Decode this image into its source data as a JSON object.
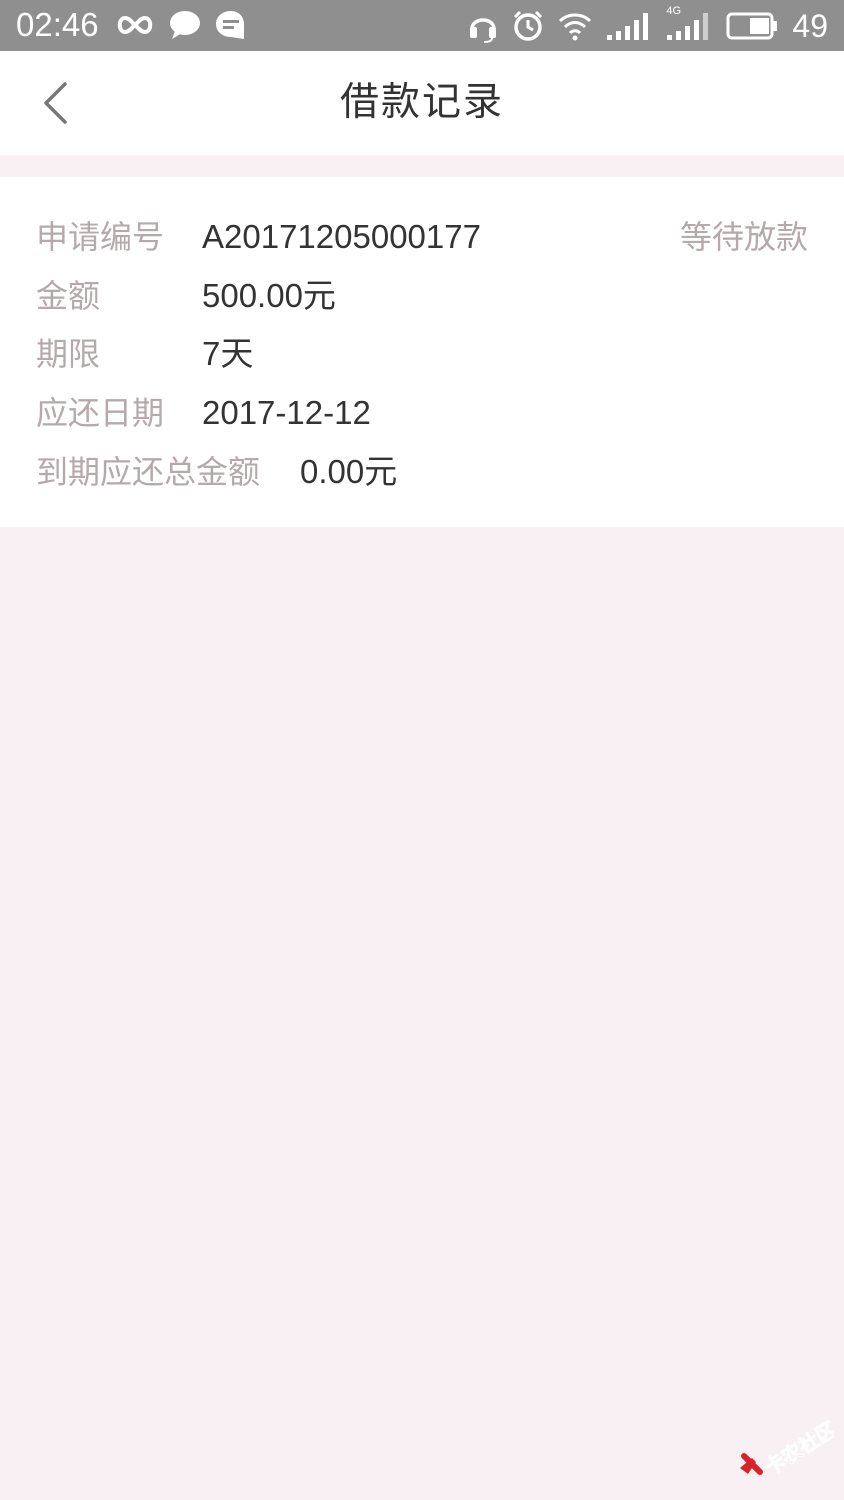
{
  "status_bar": {
    "time": "02:46",
    "battery_level": "49",
    "signal_label": "4G",
    "icons": [
      "infinity-icon",
      "chat-bubble-icon",
      "message-icon",
      "headset-icon",
      "alarm-icon",
      "wifi-icon",
      "signal-icon",
      "signal-4g-icon",
      "battery-icon"
    ]
  },
  "nav": {
    "title": "借款记录",
    "back_icon": "chevron-left-icon"
  },
  "record": {
    "status": "等待放款",
    "rows": [
      {
        "label": "申请编号",
        "value": "A20171205000177"
      },
      {
        "label": "金额",
        "value": "500.00元"
      },
      {
        "label": "期限",
        "value": "7天"
      },
      {
        "label": "应还日期",
        "value": "2017-12-12"
      },
      {
        "label": "到期应还总金额",
        "value": "0.00元"
      }
    ]
  },
  "watermark": {
    "text": "卡农社区"
  },
  "colors": {
    "status_bar_bg": "#8f8f8f",
    "page_bg": "#f9f0f3",
    "label": "#b5a9ab",
    "value": "#333333",
    "watermark": "#d8232a"
  }
}
